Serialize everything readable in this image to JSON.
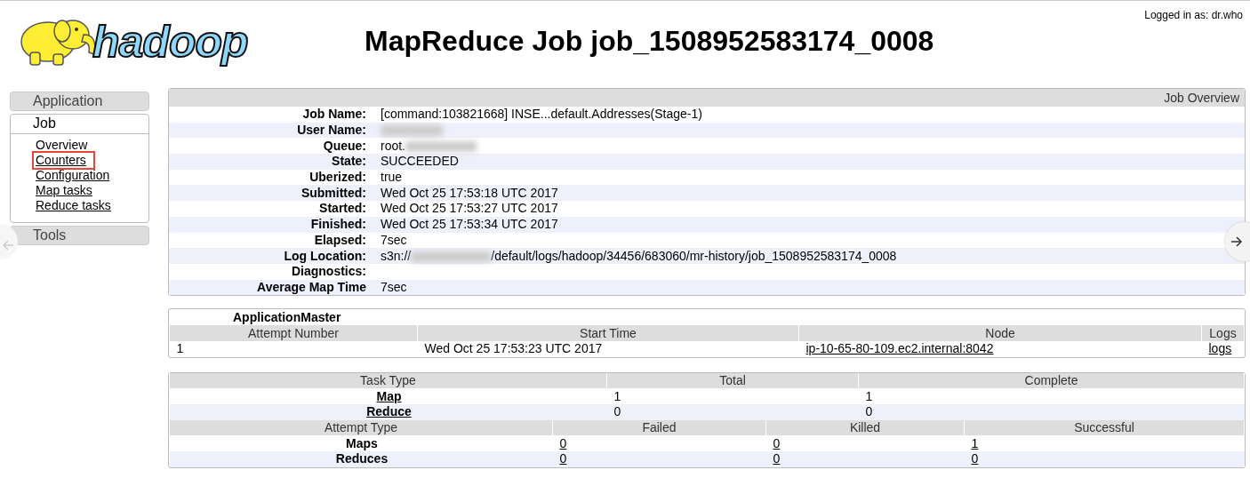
{
  "header": {
    "logo_text": "hadoop",
    "title": "MapReduce Job job_1508952583174_0008",
    "login": "Logged in as: dr.who"
  },
  "sidebar": {
    "sections": [
      {
        "label": "Application",
        "expanded": false
      },
      {
        "label": "Job",
        "expanded": true,
        "items": [
          {
            "label": "Overview",
            "highlighted": false
          },
          {
            "label": "Counters",
            "highlighted": true
          },
          {
            "label": "Configuration",
            "highlighted": false
          },
          {
            "label": "Map tasks",
            "highlighted": false
          },
          {
            "label": "Reduce tasks",
            "highlighted": false
          }
        ]
      },
      {
        "label": "Tools",
        "expanded": false
      }
    ]
  },
  "job_overview": {
    "title": "Job Overview",
    "rows": [
      {
        "label": "Job Name:",
        "parts": [
          {
            "kind": "text",
            "text": "[command:103821668] INSE...default.Addresses(Stage-1)"
          }
        ]
      },
      {
        "label": "User Name:",
        "parts": [
          {
            "kind": "redacted"
          }
        ]
      },
      {
        "label": "Queue:",
        "parts": [
          {
            "kind": "text",
            "text": "root."
          },
          {
            "kind": "redacted"
          }
        ]
      },
      {
        "label": "State:",
        "parts": [
          {
            "kind": "text",
            "text": "SUCCEEDED"
          }
        ]
      },
      {
        "label": "Uberized:",
        "parts": [
          {
            "kind": "text",
            "text": "true"
          }
        ]
      },
      {
        "label": "Submitted:",
        "parts": [
          {
            "kind": "text",
            "text": "Wed Oct 25 17:53:18 UTC 2017"
          }
        ]
      },
      {
        "label": "Started:",
        "parts": [
          {
            "kind": "text",
            "text": "Wed Oct 25 17:53:27 UTC 2017"
          }
        ]
      },
      {
        "label": "Finished:",
        "parts": [
          {
            "kind": "text",
            "text": "Wed Oct 25 17:53:34 UTC 2017"
          }
        ]
      },
      {
        "label": "Elapsed:",
        "parts": [
          {
            "kind": "text",
            "text": "7sec"
          }
        ]
      },
      {
        "label": "Log Location:",
        "parts": [
          {
            "kind": "text",
            "text": "s3n://"
          },
          {
            "kind": "redacted"
          },
          {
            "kind": "text",
            "text": "/default/logs/hadoop/34456/683060/mr-history/job_1508952583174_0008"
          }
        ]
      },
      {
        "label": "Diagnostics:",
        "parts": []
      },
      {
        "label": "Average Map Time",
        "parts": [
          {
            "kind": "text",
            "text": "7sec"
          }
        ]
      }
    ]
  },
  "application_master": {
    "title": "ApplicationMaster",
    "columns": [
      "Attempt Number",
      "Start Time",
      "Node",
      "Logs"
    ],
    "rows": [
      {
        "cells": [
          {
            "text": "1",
            "link": false
          },
          {
            "text": "Wed Oct 25 17:53:23 UTC 2017",
            "link": false
          },
          {
            "text": "ip-10-65-80-109.ec2.internal:8042",
            "link": true
          },
          {
            "text": "logs",
            "link": true
          }
        ]
      }
    ]
  },
  "tasks": {
    "columns": [
      "Task Type",
      "Total",
      "Complete"
    ],
    "rows": [
      {
        "type": "Map",
        "total": "1",
        "complete": "1"
      },
      {
        "type": "Reduce",
        "total": "0",
        "complete": "0"
      }
    ]
  },
  "attempts": {
    "columns": [
      "Attempt Type",
      "Failed",
      "Killed",
      "Successful"
    ],
    "rows": [
      {
        "type": "Maps",
        "failed": "0",
        "killed": "0",
        "successful": "1"
      },
      {
        "type": "Reduces",
        "failed": "0",
        "killed": "0",
        "successful": "0"
      }
    ]
  }
}
